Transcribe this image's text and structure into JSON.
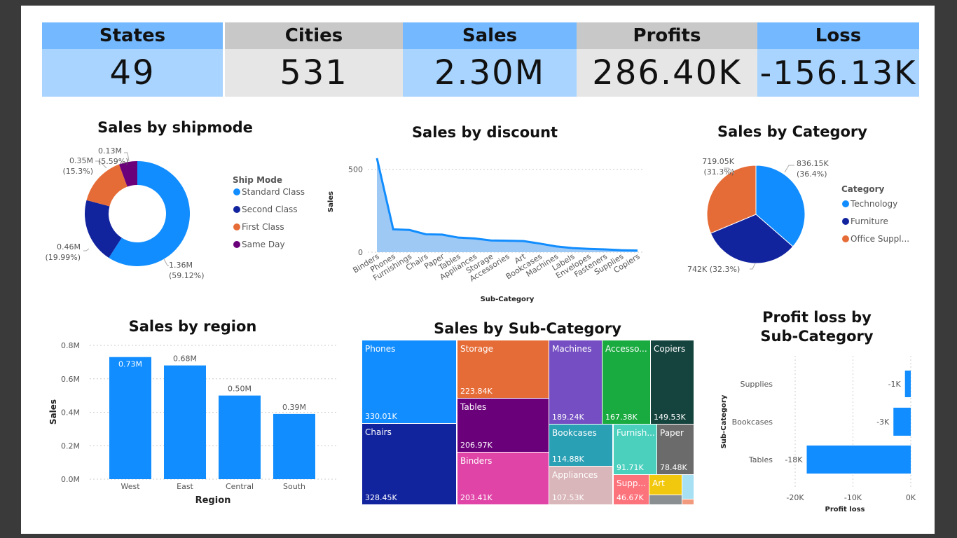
{
  "kpis": [
    {
      "label": "States",
      "value": "49",
      "head_color": "#74b9ff",
      "val_color": "#a8d4ff"
    },
    {
      "label": "Cities",
      "value": "531",
      "head_color": "#c8c8c8",
      "val_color": "#e6e6e6"
    },
    {
      "label": "Sales",
      "value": "2.30M",
      "head_color": "#74b9ff",
      "val_color": "#a8d4ff"
    },
    {
      "label": "Profits",
      "value": "286.40K",
      "head_color": "#c8c8c8",
      "val_color": "#e6e6e6"
    },
    {
      "label": "Loss",
      "value": "-156.13K",
      "head_color": "#74b9ff",
      "val_color": "#a8d4ff"
    }
  ],
  "colors": {
    "blue": "#118dff",
    "navy": "#12239e",
    "orange": "#e66c37",
    "purple": "#6b007b"
  },
  "chart_data": [
    {
      "id": "shipmode",
      "type": "pie",
      "donut": true,
      "title": "Sales by shipmode",
      "legend_title": "Ship Mode",
      "legend_position": "right",
      "slices": [
        {
          "name": "Standard Class",
          "value": 1.36,
          "value_label": "1.36M",
          "pct_label": "(59.12%)",
          "color": "#118dff"
        },
        {
          "name": "Second Class",
          "value": 0.46,
          "value_label": "0.46M",
          "pct_label": "(19.99%)",
          "color": "#12239e"
        },
        {
          "name": "First Class",
          "value": 0.35,
          "value_label": "0.35M",
          "pct_label": "(15.3%)",
          "color": "#e66c37"
        },
        {
          "name": "Same Day",
          "value": 0.13,
          "value_label": "0.13M",
          "pct_label": "(5.59%)",
          "color": "#6b007b"
        }
      ]
    },
    {
      "id": "discount",
      "type": "area",
      "title": "Sales by discount",
      "xlabel": "Sub-Category",
      "ylabel": "Sales",
      "categories": [
        "Binders",
        "Phones",
        "Furnishings",
        "Chairs",
        "Paper",
        "Tables",
        "Appliances",
        "Storage",
        "Accessories",
        "Art",
        "Bookcases",
        "Machines",
        "Labels",
        "Envelopes",
        "Fasteners",
        "Supplies",
        "Copiers"
      ],
      "values": [
        567,
        138,
        134,
        108,
        106,
        88,
        83,
        71,
        69,
        67,
        52,
        35,
        25,
        20,
        17,
        12,
        10
      ],
      "yticks": [
        0,
        500
      ],
      "ylim": [
        0,
        600
      ],
      "grid": true
    },
    {
      "id": "category",
      "type": "pie",
      "title": "Sales by Category",
      "legend_title": "Category",
      "legend_position": "right",
      "slices": [
        {
          "name": "Technology",
          "value": 836.15,
          "label": "836.15K",
          "pct_label": "(36.4%)",
          "color": "#118dff"
        },
        {
          "name": "Furniture",
          "value": 742,
          "label": "742K (32.3%)",
          "color": "#12239e"
        },
        {
          "name": "Office Suppl...",
          "value": 719.05,
          "label": "719.05K",
          "pct_label": "(31.3%)",
          "color": "#e66c37"
        }
      ]
    },
    {
      "id": "region",
      "type": "bar",
      "title": "Sales by region",
      "xlabel": "Region",
      "ylabel": "Sales",
      "categories": [
        "West",
        "East",
        "Central",
        "South"
      ],
      "values": [
        0.73,
        0.68,
        0.5,
        0.39
      ],
      "value_labels": [
        "0.73M",
        "0.68M",
        "0.50M",
        "0.39M"
      ],
      "ylim": [
        0,
        0.8
      ],
      "yticks": [
        "0.0M",
        "0.2M",
        "0.4M",
        "0.6M",
        "0.8M"
      ],
      "grid": true,
      "color": "#118dff"
    },
    {
      "id": "subcategory",
      "type": "treemap",
      "title": "Sales by Sub-Category",
      "items": [
        {
          "name": "Phones",
          "label": "330.01K",
          "color": "#118dff"
        },
        {
          "name": "Chairs",
          "label": "328.45K",
          "color": "#12239e"
        },
        {
          "name": "Storage",
          "label": "223.84K",
          "color": "#e66c37"
        },
        {
          "name": "Tables",
          "label": "206.97K",
          "color": "#6b007b"
        },
        {
          "name": "Binders",
          "label": "203.41K",
          "color": "#e044a7"
        },
        {
          "name": "Machines",
          "label": "189.24K",
          "color": "#744ec2"
        },
        {
          "name": "Accesso...",
          "label": "167.38K",
          "color": "#1aab40"
        },
        {
          "name": "Copiers",
          "label": "149.53K",
          "color": "#15433e"
        },
        {
          "name": "Bookcases",
          "label": "114.88K",
          "color": "#2aa0b5"
        },
        {
          "name": "Furnish...",
          "label": "91.71K",
          "color": "#4bd0be"
        },
        {
          "name": "Paper",
          "label": "78.48K",
          "color": "#6b6b6b"
        },
        {
          "name": "Appliances",
          "label": "107.53K",
          "color": "#d9b6b9"
        },
        {
          "name": "Supp...",
          "label": "46.67K",
          "color": "#fc737c"
        },
        {
          "name": "Art",
          "label": "",
          "color": "#f2c80f"
        },
        {
          "name": "",
          "label": "",
          "color": "#a6e0f2"
        },
        {
          "name": "",
          "label": "",
          "color": "#8a8f92"
        },
        {
          "name": "",
          "label": "",
          "color": "#f29a7e"
        }
      ]
    },
    {
      "id": "profitloss",
      "type": "bar",
      "orientation": "horizontal",
      "title_lines": [
        "Profit loss by",
        "Sub-Category"
      ],
      "xlabel": "Profit loss",
      "ylabel": "Sub-Category",
      "categories": [
        "Supplies",
        "Bookcases",
        "Tables"
      ],
      "values": [
        -1,
        -3,
        -18
      ],
      "value_labels": [
        "-1K",
        "-3K",
        "-18K"
      ],
      "xlim": [
        -20,
        0
      ],
      "xticks": [
        "-20K",
        "-10K",
        "0K"
      ],
      "grid": true,
      "color": "#118dff"
    }
  ]
}
